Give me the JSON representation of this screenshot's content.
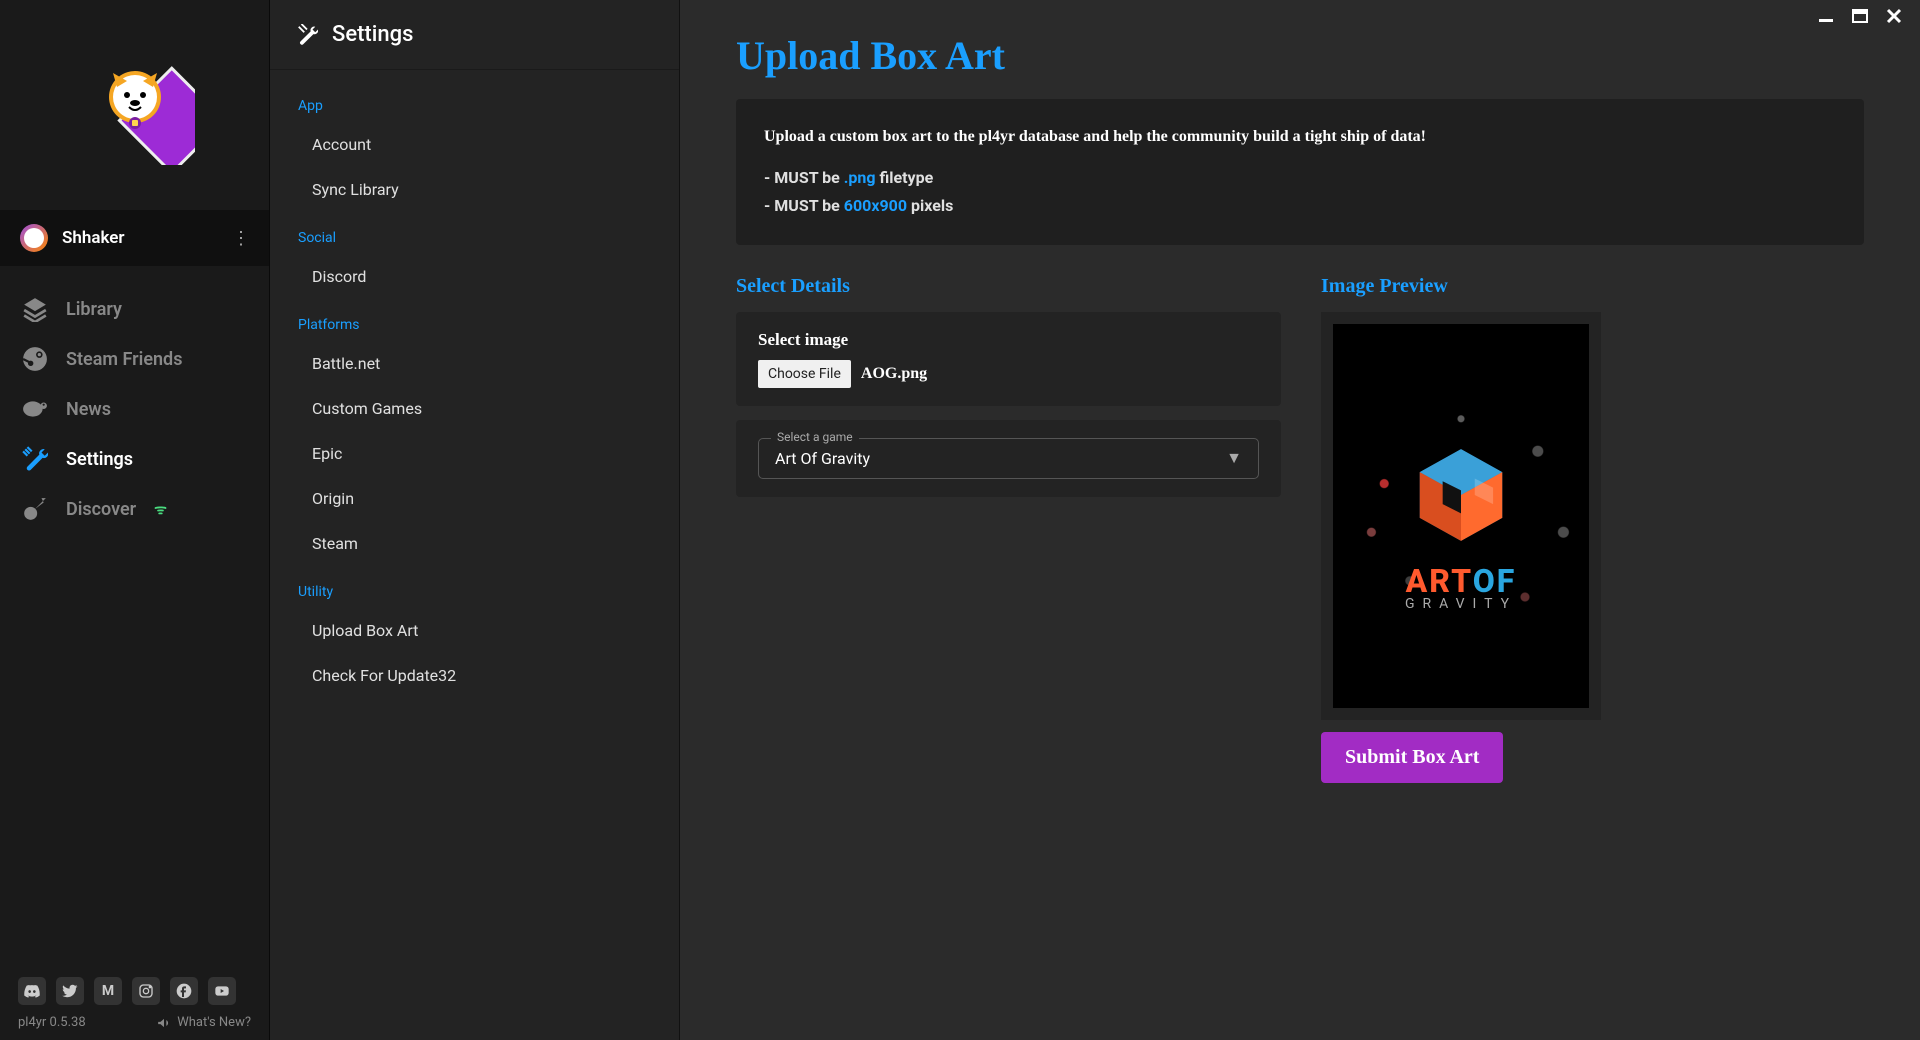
{
  "user": {
    "name": "Shhaker"
  },
  "nav": [
    {
      "key": "library",
      "label": "Library"
    },
    {
      "key": "steam-friends",
      "label": "Steam Friends"
    },
    {
      "key": "news",
      "label": "News"
    },
    {
      "key": "settings",
      "label": "Settings"
    },
    {
      "key": "discover",
      "label": "Discover",
      "badge": "ᯤ"
    }
  ],
  "bottom": {
    "version": "pl4yr 0.5.38",
    "whats_new": "What's New?"
  },
  "settings": {
    "title": "Settings",
    "groups": [
      {
        "label": "App",
        "items": [
          "Account",
          "Sync Library"
        ]
      },
      {
        "label": "Social",
        "items": [
          "Discord"
        ]
      },
      {
        "label": "Platforms",
        "items": [
          "Battle.net",
          "Custom Games",
          "Epic",
          "Origin",
          "Steam"
        ]
      },
      {
        "label": "Utility",
        "items": [
          "Upload Box Art",
          "Check For Update32"
        ]
      }
    ]
  },
  "page": {
    "title": "Upload Box Art",
    "intro": "Upload a custom box art to the pl4yr database and help the community build a tight ship of data!",
    "rule1_prefix": "- MUST be ",
    "rule1_accent": ".png",
    "rule1_suffix": " filetype",
    "rule2_prefix": "- MUST be ",
    "rule2_accent": "600x900",
    "rule2_suffix": " pixels",
    "select_details": "Select Details",
    "select_image_label": "Select image",
    "choose_file": "Choose File",
    "file_name": "AOG.png",
    "game_select_label": "Select a game",
    "game_selected": "Art Of Gravity",
    "preview_label": "Image Preview",
    "preview_line1a": "ART",
    "preview_line1b": "OF",
    "preview_line2": "GRAVITY",
    "submit": "Submit Box Art"
  }
}
